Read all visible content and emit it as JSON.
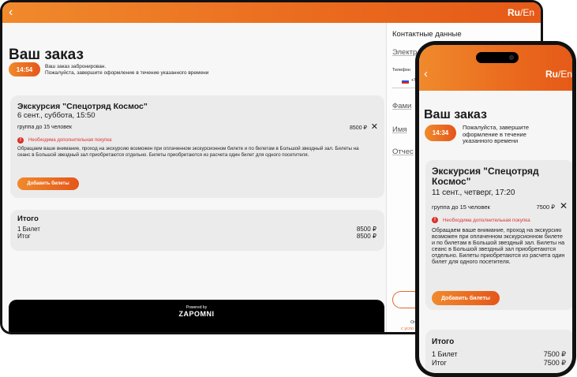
{
  "lang": {
    "active": "Ru",
    "separator": "/",
    "other": "En"
  },
  "back_icon": "chevron-left-icon",
  "colors": {
    "accent": "#ea6a1e",
    "accent_light": "#f08a2c",
    "warning": "#d9312b",
    "card": "#ebebeb"
  },
  "tablet": {
    "title": "Ваш заказ",
    "timer": "14:54",
    "note_line1": "Ваш заказ забронирован.",
    "note_line2": "Пожалуйста, завершите оформление в течение указанного времени",
    "excursion": {
      "title": "Экскурсия \"Спецотряд Космос\"",
      "date": "6 сент., суббота, 15:50",
      "ticket": "группа до 15 человек",
      "price": "8500 ₽",
      "warning": "Необходима дополнительная покупка",
      "notice": "Обращаем ваше внимание, проход на экскурсию возможен при оплаченном экскурсионном билете и по билетам в Большой звездный зал. Билеты на сеанс в Большой звездный зал приобретаются отдельно. Билеты приобретаются из расчета один билет для одного посетителя.",
      "add_button": "Добавить билеты"
    },
    "total": {
      "title": "Итого",
      "row1_label": "1 Билет",
      "row1_value": "8500 ₽",
      "row2_label": "Итог",
      "row2_value": "8500 ₽"
    },
    "powered_by": "Powered by",
    "brand": "ZAPOMNI",
    "side": {
      "heading": "Контактные данные",
      "email_label": "Электр",
      "phone_label": "Телефон",
      "phone_code": "+7",
      "surname_label": "Фами",
      "name_label": "Имя",
      "patronymic_label": "Отчес",
      "bottom_text1": "Оп",
      "bottom_text2": "с усло"
    }
  },
  "phone": {
    "title": "Ваш заказ",
    "timer": "14:34",
    "note": "Пожалуйста, завершите оформление в течение указанного времени",
    "excursion": {
      "title": "Экскурсия \"Спецотряд Космос\"",
      "date": "11 сент., четверг, 17:20",
      "ticket": "группа до 15 человек",
      "price": "7500 ₽",
      "warning": "Необходима дополнительная покупка",
      "notice": "Обращаем ваше внимание, проход на экскурсию возможен при оплаченном экскурсионном билете и по билетам в Большой звездный зал. Билеты на сеанс в Большой звездный зал приобретаются отдельно. Билеты приобретаются из расчета один билет для одного посетителя.",
      "add_button": "Добавить билеты"
    },
    "total": {
      "title": "Итого",
      "row1_label": "1 Билет",
      "row1_value": "7500 ₽",
      "row2_label": "Итог",
      "row2_value": "7500 ₽"
    }
  }
}
